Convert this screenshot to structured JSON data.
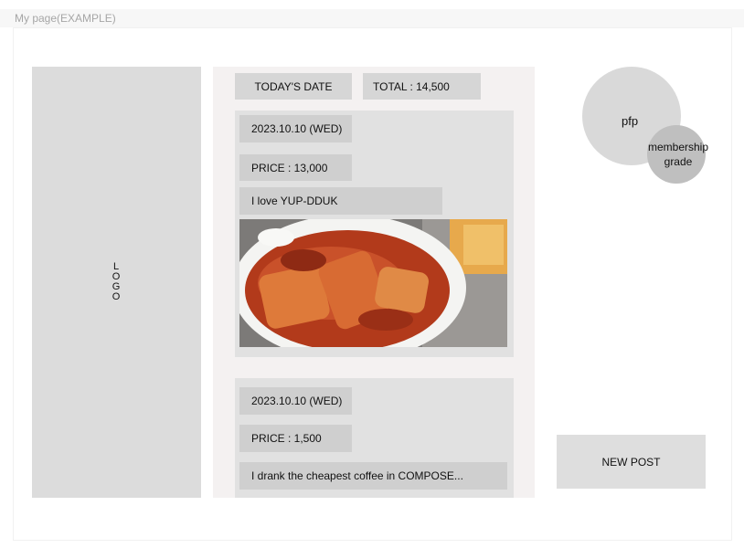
{
  "page": {
    "title": "My page(EXAMPLE)"
  },
  "logo": {
    "text": "LOGO"
  },
  "summary": {
    "date_label": "TODAY'S DATE",
    "total_label": "TOTAL : 14,500"
  },
  "posts": [
    {
      "date": "2023.10.10 (WED)",
      "price": "PRICE : 13,000",
      "caption": "I love YUP-DDUK",
      "photo": "food-photo"
    },
    {
      "date": "2023.10.10 (WED)",
      "price": "PRICE : 1,500",
      "caption": "I drank the cheapest coffee in COMPOSE..."
    }
  ],
  "profile": {
    "pfp_label": "pfp",
    "grade_label": "membership grade"
  },
  "actions": {
    "new_post_label": "NEW POST"
  }
}
